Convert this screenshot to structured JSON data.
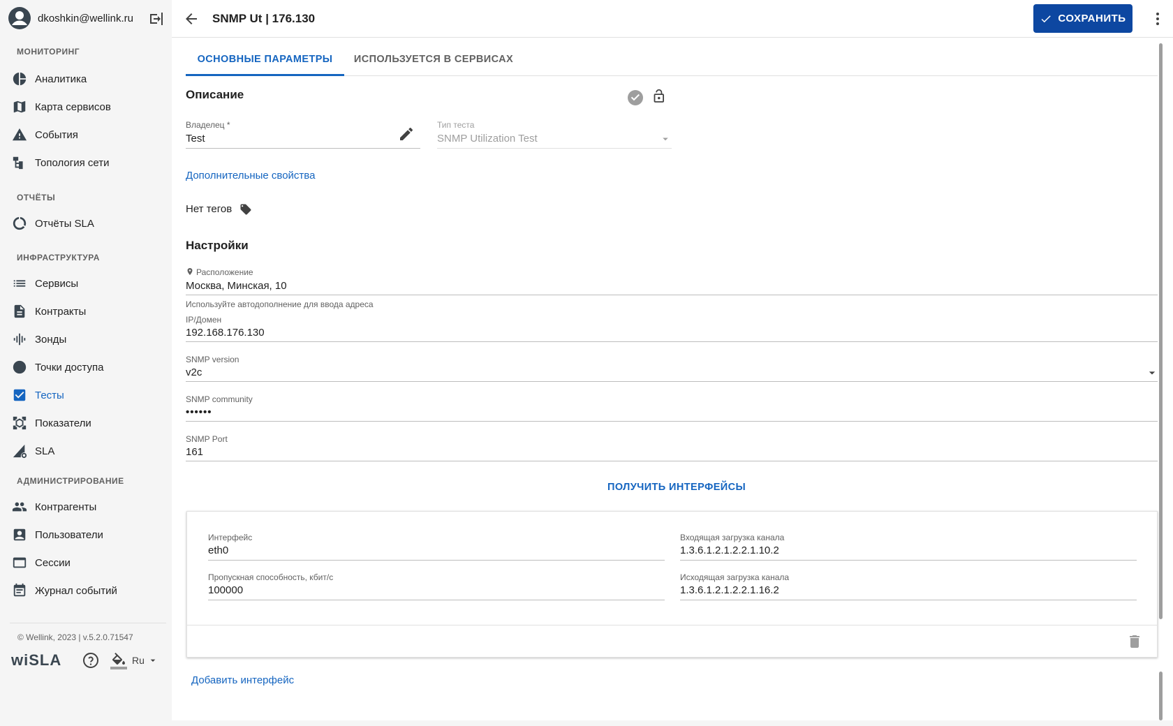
{
  "user": {
    "email": "dkoshkin@wellink.ru"
  },
  "sidebar": {
    "sections": [
      {
        "title": "МОНИТОРИНГ"
      },
      {
        "title": "ОТЧЁТЫ"
      },
      {
        "title": "ИНФРАСТРУКТУРА"
      },
      {
        "title": "АДМИНИСТРИРОВАНИЕ"
      }
    ],
    "items": [
      {
        "label": "Аналитика",
        "icon": "pie-chart-icon"
      },
      {
        "label": "Карта сервисов",
        "icon": "map-icon"
      },
      {
        "label": "События",
        "icon": "warning-icon"
      },
      {
        "label": "Топология сети",
        "icon": "topology-icon"
      },
      {
        "label": "Отчёты SLA",
        "icon": "reports-icon"
      },
      {
        "label": "Сервисы",
        "icon": "list-icon"
      },
      {
        "label": "Контракты",
        "icon": "document-icon"
      },
      {
        "label": "Зонды",
        "icon": "probe-icon"
      },
      {
        "label": "Точки доступа",
        "icon": "circle-icon"
      },
      {
        "label": "Тесты",
        "icon": "checkbox-icon",
        "active": true
      },
      {
        "label": "Показатели",
        "icon": "metrics-icon"
      },
      {
        "label": "SLA",
        "icon": "sla-icon"
      },
      {
        "label": "Контрагенты",
        "icon": "people-icon"
      },
      {
        "label": "Пользователи",
        "icon": "user-card-icon"
      },
      {
        "label": "Сессии",
        "icon": "window-icon"
      },
      {
        "label": "Журнал событий",
        "icon": "calendar-icon"
      }
    ],
    "copyright": "© Wellink, 2023 | v.5.2.0.71547",
    "logo": "wiSLA",
    "language": "Ru"
  },
  "header": {
    "title": "SNMP Ut | 176.130",
    "save_label": "СОХРАНИТЬ"
  },
  "tabs": [
    {
      "label": "ОСНОВНЫЕ ПАРАМЕТРЫ",
      "active": true
    },
    {
      "label": "ИСПОЛЬЗУЕТСЯ В СЕРВИСАХ",
      "active": false
    }
  ],
  "description": {
    "title": "Описание",
    "owner_label": "Владелец *",
    "owner_value": "Test",
    "test_type_label": "Тип теста",
    "test_type_value": "SNMP Utilization Test",
    "extra_props_link": "Дополнительные свойства",
    "no_tags": "Нет тегов"
  },
  "settings": {
    "title": "Настройки",
    "location_label": "Расположение",
    "location_value": "Москва, Минская, 10",
    "location_hint": "Используйте автодополнение для ввода адреса",
    "ip_label": "IP/Домен",
    "ip_value": "192.168.176.130",
    "snmp_version_label": "SNMP version",
    "snmp_version_value": "v2c",
    "snmp_community_label": "SNMP community",
    "snmp_community_value": "••••••",
    "snmp_port_label": "SNMP Port",
    "snmp_port_value": "161",
    "get_interfaces_label": "ПОЛУЧИТЬ ИНТЕРФЕЙСЫ"
  },
  "interface": {
    "iface_label": "Интерфейс",
    "iface_value": "eth0",
    "in_load_label": "Входящая загрузка канала",
    "in_load_value": "1.3.6.1.2.1.2.2.1.10.2",
    "bandwidth_label": "Пропускная способность, кбит/с",
    "bandwidth_value": "100000",
    "out_load_label": "Исходящая загрузка канала",
    "out_load_value": "1.3.6.1.2.1.2.2.1.16.2",
    "add_link": "Добавить интерфейс"
  },
  "colors": {
    "accent": "#1565c0",
    "save_button": "#0d47a1",
    "sidebar_bg": "#f5f5f5"
  }
}
